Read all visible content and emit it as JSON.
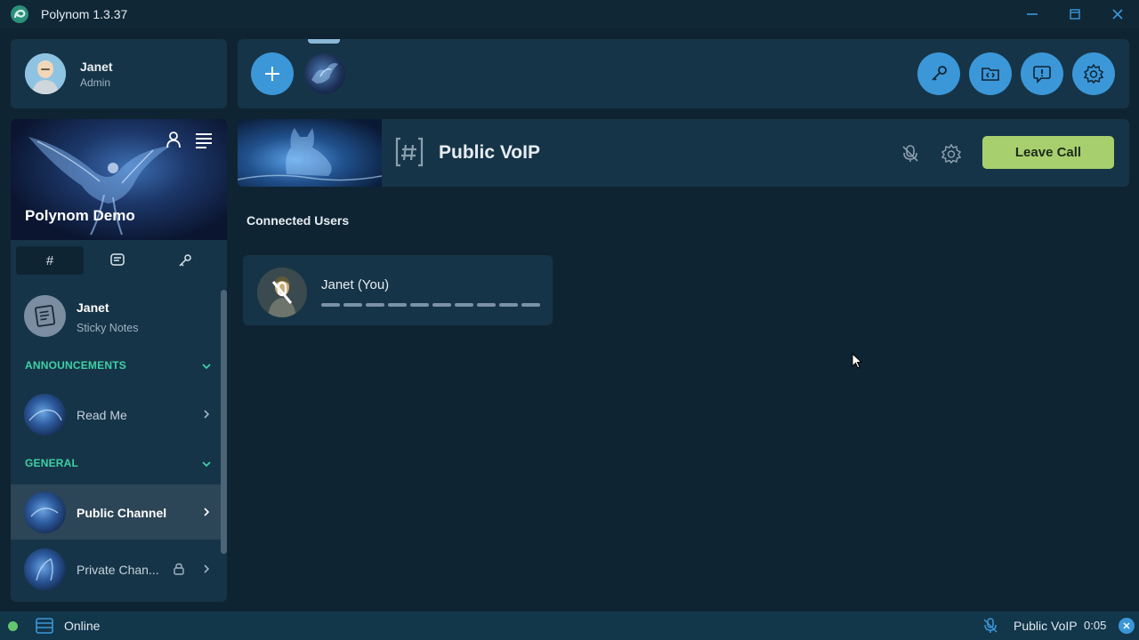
{
  "window": {
    "title": "Polynom 1.3.37"
  },
  "user": {
    "name": "Janet",
    "role": "Admin"
  },
  "server": {
    "name": "Polynom Demo"
  },
  "sidebar_tabs": [
    {
      "label": "#",
      "icon": "hash-icon",
      "active": true
    },
    {
      "label": "",
      "icon": "message-icon",
      "active": false
    },
    {
      "label": "",
      "icon": "key-icon",
      "active": false
    }
  ],
  "notes": {
    "title": "Janet",
    "subtitle": "Sticky Notes"
  },
  "sections": {
    "announcements": "ANNOUNCEMENTS",
    "general": "GENERAL"
  },
  "channels": {
    "read_me": "Read Me",
    "public": "Public Channel",
    "private": "Private Chan..."
  },
  "channel_header": {
    "title": "Public VoIP",
    "leave_label": "Leave Call"
  },
  "connected": {
    "label": "Connected Users",
    "users": [
      {
        "name": "Janet (You)",
        "muted": true
      }
    ]
  },
  "status": {
    "presence": "Online",
    "presence_color": "#64c66f",
    "call_channel": "Public VoIP",
    "call_time": "0:05"
  },
  "colors": {
    "accent": "#3b97d8",
    "section": "#3fd0a6",
    "leave": "#a8cf6e"
  }
}
